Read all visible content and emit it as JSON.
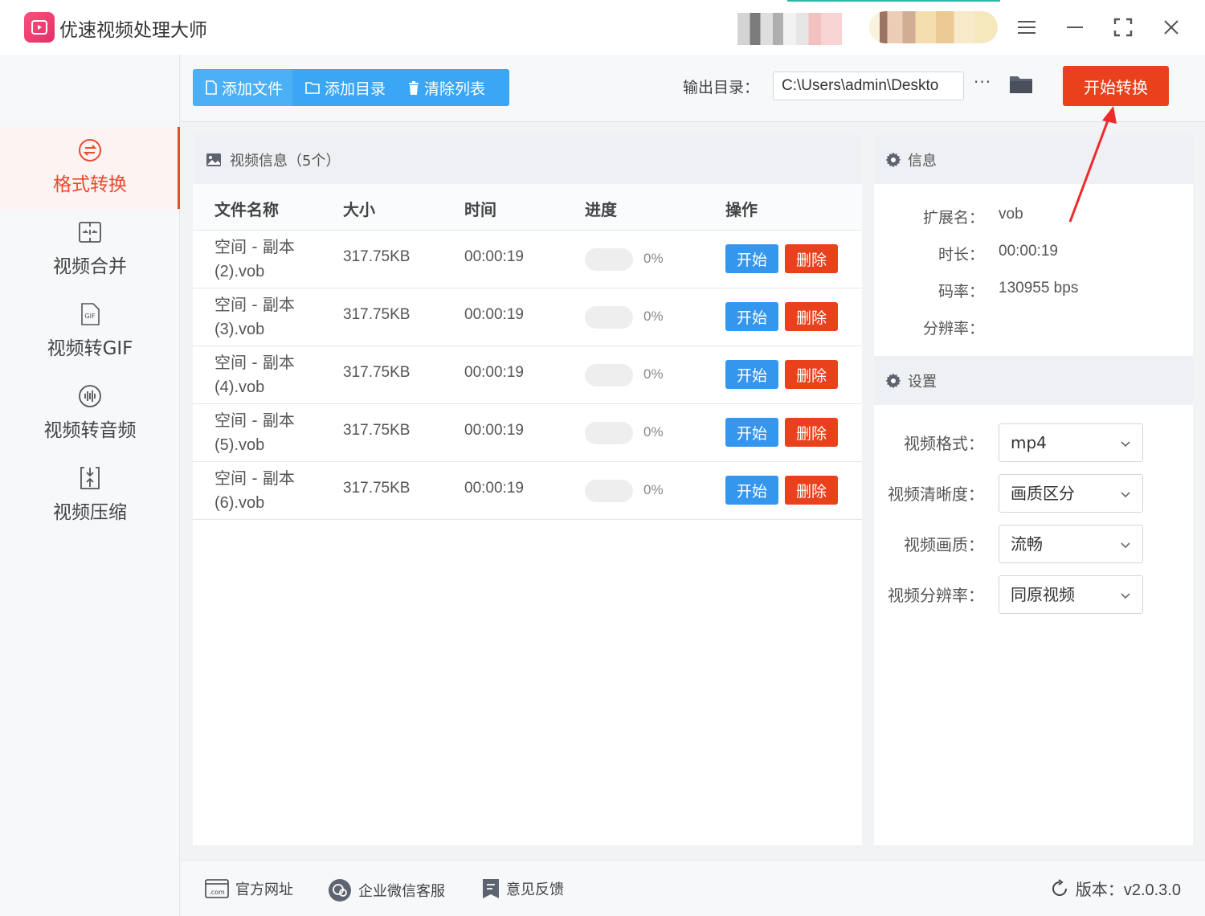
{
  "app": {
    "title": "优速视频处理大师",
    "icons": {
      "logo": "video-play-logo",
      "menu": "menu-icon",
      "minimize": "minimize-icon",
      "maximize": "fullscreen-icon",
      "close": "close-icon"
    }
  },
  "sidebar": {
    "items": [
      {
        "label": "格式转换",
        "icon": "format-convert-icon",
        "active": true
      },
      {
        "label": "视频合并",
        "icon": "merge-icon",
        "active": false
      },
      {
        "label": "视频转GIF",
        "icon": "gif-icon",
        "active": false
      },
      {
        "label": "视频转音频",
        "icon": "audio-icon",
        "active": false
      },
      {
        "label": "视频压缩",
        "icon": "compress-icon",
        "active": false
      }
    ]
  },
  "toolbar": {
    "add_file": "添加文件",
    "add_dir": "添加目录",
    "clear_list": "清除列表",
    "output_label": "输出目录：",
    "output_path": "C:\\Users\\admin\\Deskto",
    "more": "···",
    "start_convert": "开始转换"
  },
  "file_panel": {
    "header": "视频信息（5个）",
    "columns": [
      "文件名称",
      "大小",
      "时间",
      "进度",
      "操作"
    ],
    "rows": [
      {
        "name_line1": "空间 - 副本",
        "name_line2": "(2).vob",
        "size": "317.75KB",
        "time": "00:00:19",
        "progress": "0%",
        "progress_value": 0,
        "start": "开始",
        "delete": "删除"
      },
      {
        "name_line1": "空间 - 副本",
        "name_line2": "(3).vob",
        "size": "317.75KB",
        "time": "00:00:19",
        "progress": "0%",
        "progress_value": 0,
        "start": "开始",
        "delete": "删除"
      },
      {
        "name_line1": "空间 - 副本",
        "name_line2": "(4).vob",
        "size": "317.75KB",
        "time": "00:00:19",
        "progress": "0%",
        "progress_value": 0,
        "start": "开始",
        "delete": "删除"
      },
      {
        "name_line1": "空间 - 副本",
        "name_line2": "(5).vob",
        "size": "317.75KB",
        "time": "00:00:19",
        "progress": "0%",
        "progress_value": 0,
        "start": "开始",
        "delete": "删除"
      },
      {
        "name_line1": "空间 - 副本",
        "name_line2": "(6).vob",
        "size": "317.75KB",
        "time": "00:00:19",
        "progress": "0%",
        "progress_value": 0,
        "start": "开始",
        "delete": "删除"
      }
    ]
  },
  "info_panel": {
    "header": "信息",
    "items": [
      {
        "key": "扩展名：",
        "value": "vob"
      },
      {
        "key": "时长：",
        "value": "00:00:19"
      },
      {
        "key": "码率：",
        "value": "130955 bps"
      },
      {
        "key": "分辨率：",
        "value": ""
      }
    ]
  },
  "settings_panel": {
    "header": "设置",
    "items": [
      {
        "label": "视频格式：",
        "value": "mp4"
      },
      {
        "label": "视频清晰度：",
        "value": "画质区分"
      },
      {
        "label": "视频画质：",
        "value": "流畅"
      },
      {
        "label": "视频分辨率：",
        "value": "同原视频"
      }
    ]
  },
  "footer": {
    "website": "官方网址",
    "wechat": "企业微信客服",
    "feedback": "意见反馈",
    "version": "版本：v2.0.3.0"
  },
  "colors": {
    "accent_red": "#e8411c",
    "accent_blue": "#3596ee",
    "toolbar_blue": "#3ba6f4",
    "active_nav": "#e84a2f"
  }
}
